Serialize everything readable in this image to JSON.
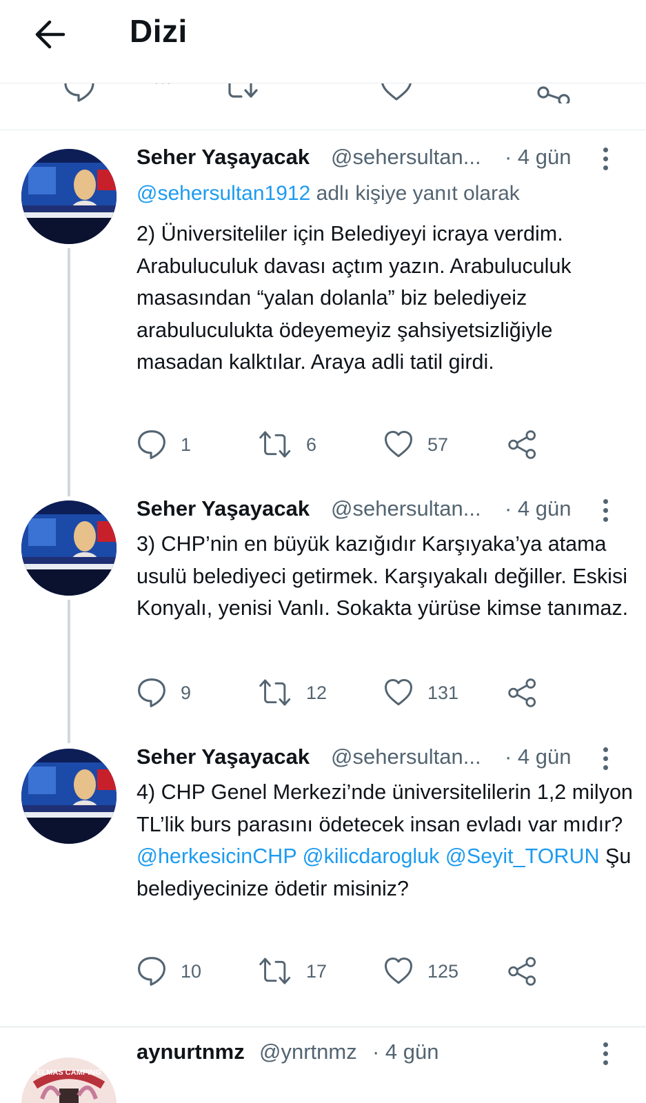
{
  "header": {
    "title": "Dizi"
  },
  "colors": {
    "link": "#1d9bf0",
    "secondary": "#536471",
    "text": "#0f1419",
    "divider": "#e6ecf0"
  },
  "tweets": [
    {
      "name": "Seher Yaşayacak",
      "handle": "@sehersultan...",
      "time": "· 4 gün",
      "reply_mention": "@sehersultan1912",
      "reply_suffix": " adlı kişiye yanıt olarak",
      "text": "2) Üniversiteliler için Belediyeyi icraya verdim. Arabuluculuk davası açtım yazın. Arabuluculuk masasından “yalan dolanla” biz belediyeiz arabuluculukta ödeyemeyiz şahsiyetsizliğiyle masadan kalktılar. Araya adli tatil girdi.",
      "replies": "1",
      "retweets": "6",
      "likes": "57"
    },
    {
      "name": "Seher Yaşayacak",
      "handle": "@sehersultan...",
      "time": "· 4 gün",
      "text": "3) CHP’nin en büyük kazığıdır Karşıyaka’ya atama usulü belediyeci getirmek. Karşıyakalı değiller. Eskisi Konyalı, yenisi Vanlı. Sokakta yürüse kimse tanımaz.",
      "replies": "9",
      "retweets": "12",
      "likes": "131"
    },
    {
      "name": "Seher Yaşayacak",
      "handle": "@sehersultan...",
      "time": "· 4 gün",
      "text_parts": [
        "4) CHP Genel Merkezi’nde üniversitelilerin 1,2 milyon TL’lik burs parasını ödetecek insan evladı var mıdır? ",
        "@herkesicinCHP",
        " ",
        "@kilicdarogluk",
        " ",
        "@Seyit_TORUN",
        " Şu belediyecinize ödetir misiniz?"
      ],
      "replies": "10",
      "retweets": "17",
      "likes": "125"
    },
    {
      "name": "aynurtnmz",
      "handle": "@ynrtnmz",
      "time": "· 4 gün",
      "avatar_text": "ELMAS CAMPING"
    }
  ]
}
